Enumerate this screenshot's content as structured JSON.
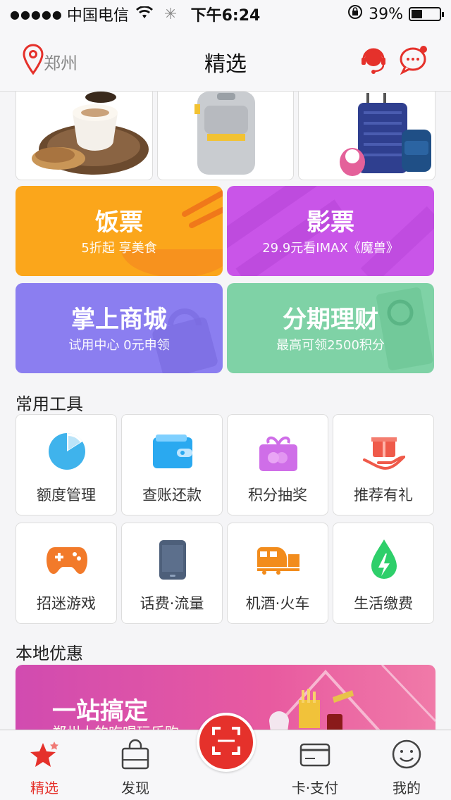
{
  "status_bar": {
    "carrier": "中国电信",
    "time": "下午6:24",
    "battery": "39%",
    "battery_level": 0.39
  },
  "nav": {
    "city": "郑州",
    "title": "精选"
  },
  "promos": [
    {
      "title": "饭票",
      "subtitle": "5折起 享美食",
      "color": "#fba61b"
    },
    {
      "title": "影票",
      "subtitle": "29.9元看IMAX《魔兽》",
      "color": "#c955e8"
    },
    {
      "title": "掌上商城",
      "subtitle": "试用中心  0元申领",
      "color": "#8b7ef0"
    },
    {
      "title": "分期理财",
      "subtitle": "最高可领2500积分",
      "color": "#7fd2a6"
    }
  ],
  "tools": {
    "title": "常用工具",
    "items": [
      {
        "label": "额度管理",
        "icon": "pie-chart-icon"
      },
      {
        "label": "查账还款",
        "icon": "wallet-icon"
      },
      {
        "label": "积分抽奖",
        "icon": "gift-box-icon"
      },
      {
        "label": "推荐有礼",
        "icon": "gift-hand-icon"
      },
      {
        "label": "招迷游戏",
        "icon": "gamepad-icon"
      },
      {
        "label": "话费·流量",
        "icon": "phone-icon"
      },
      {
        "label": "机酒·火车",
        "icon": "train-icon"
      },
      {
        "label": "生活缴费",
        "icon": "drop-bolt-icon"
      }
    ]
  },
  "local": {
    "title": "本地优惠",
    "banner_title": "一站搞定",
    "banner_subtitle": "郑州人的吃喝玩乐购"
  },
  "tabs": [
    {
      "label": "精选",
      "icon": "star-icon",
      "active": true
    },
    {
      "label": "发现",
      "icon": "bag-icon",
      "active": false
    },
    {
      "label": "卡·支付",
      "icon": "card-icon",
      "active": false
    },
    {
      "label": "我的",
      "icon": "smile-icon",
      "active": false
    }
  ],
  "colors": {
    "accent": "#e5312b"
  }
}
